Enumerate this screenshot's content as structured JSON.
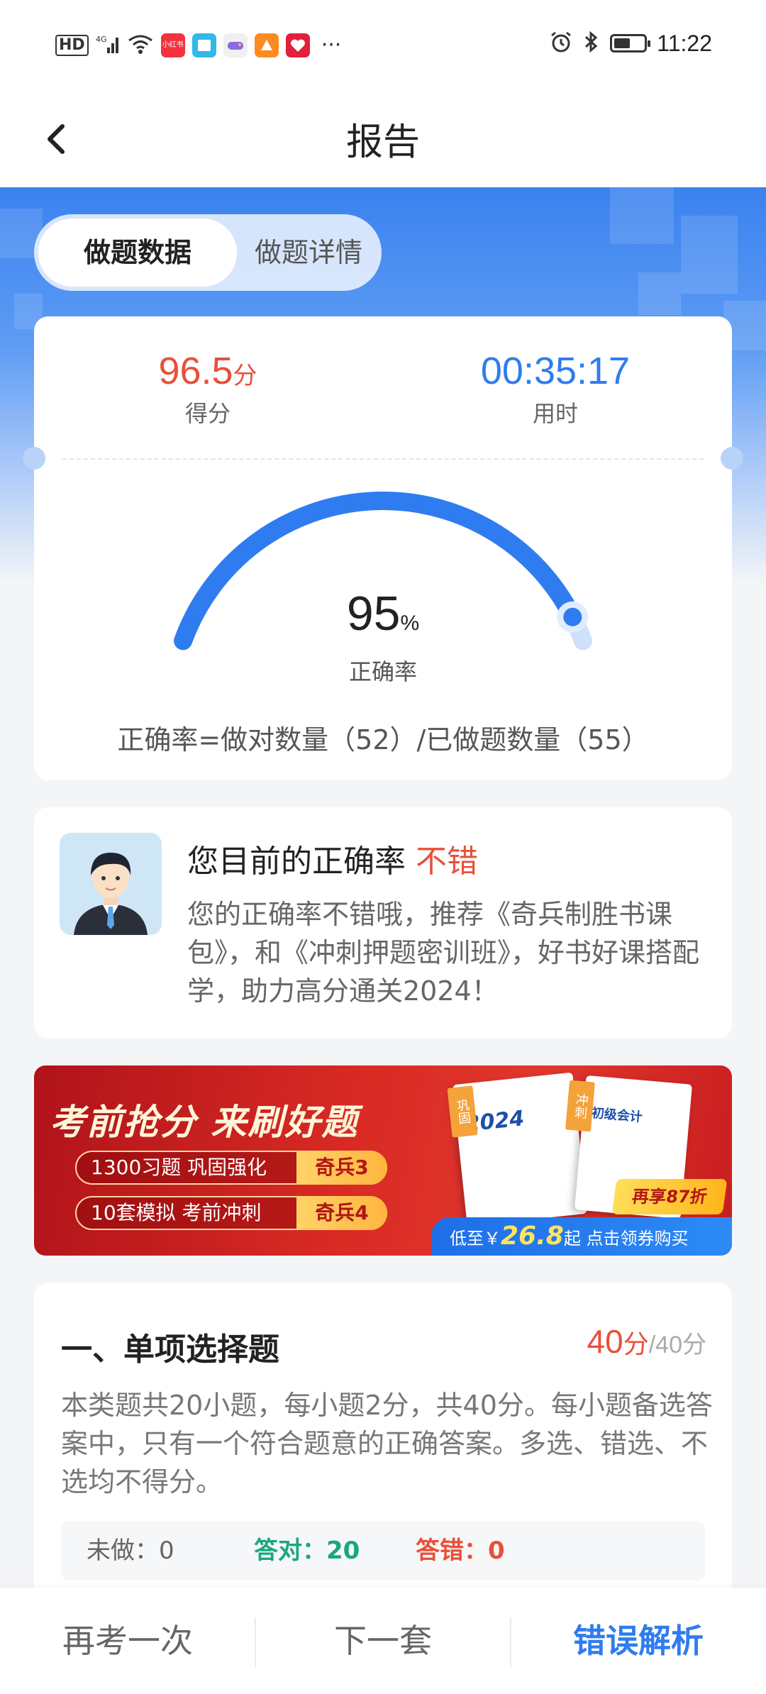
{
  "status_bar": {
    "left": {
      "hd": "HD",
      "signal": "4G"
    },
    "app_icons": [
      {
        "name": "xiaohongshu-app-icon",
        "color": "#f2323c",
        "label": "小红书"
      },
      {
        "name": "reader-app-icon",
        "color": "#33b8e8",
        "label": ""
      },
      {
        "name": "game-app-icon",
        "color": "#f0f0f0",
        "label": ""
      },
      {
        "name": "taobao-app-icon",
        "color": "#ff8a1f",
        "label": ""
      },
      {
        "name": "health-app-icon",
        "color": "#e2203a",
        "label": ""
      }
    ],
    "more": "···",
    "time": "11:22"
  },
  "nav": {
    "title": "报告"
  },
  "tabs": [
    {
      "label": "做题数据",
      "active": true
    },
    {
      "label": "做题详情",
      "active": false
    }
  ],
  "score_card": {
    "score_value": "96.5",
    "score_unit": "分",
    "score_label": "得分",
    "time_value": "00:35:17",
    "time_label": "用时",
    "accuracy_value": "95",
    "accuracy_unit": "%",
    "accuracy_fraction": 0.95,
    "accuracy_label": "正确率",
    "formula": "正确率=做对数量（52）/已做题数量（55）"
  },
  "comment_card": {
    "title_prefix": "您目前的正确率",
    "title_highlight": "不错",
    "text": "您的正确率不错哦，推荐《奇兵制胜书课包》，和《冲刺押题密训班》，好书好课搭配学，助力高分通关2024！"
  },
  "banner": {
    "title": "考前抢分 来刷好题",
    "rows": [
      {
        "text": "1300习题 巩固强化",
        "tag": "奇兵3"
      },
      {
        "text": "10套模拟 考前冲刺",
        "tag": "奇兵4"
      }
    ],
    "book1_tag": "巩固",
    "book1_title": "2024",
    "book2_tag": "冲刺",
    "book2_title": "初级会计",
    "discount": "再享87折",
    "cta_prefix": "低至￥",
    "cta_price": "26.8",
    "cta_suffix": "起  点击领券购买"
  },
  "section": {
    "title": "一、单项选择题",
    "score_got": "40",
    "score_unit": "分",
    "score_total": "/40分",
    "description": "本类题共20小题，每小题2分，共40分。每小题备选答案中，只有一个符合题意的正确答案。多选、错选、不选均不得分。",
    "stats": {
      "undone": "未做：0",
      "correct": "答对：20",
      "wrong": "答错：0"
    }
  },
  "bottom_bar": {
    "retake": "再考一次",
    "next": "下一套",
    "analysis": "错误解析"
  },
  "colors": {
    "accent_blue": "#2f7cf0",
    "score_red": "#e8503a",
    "correct_green": "#1aa87a"
  }
}
